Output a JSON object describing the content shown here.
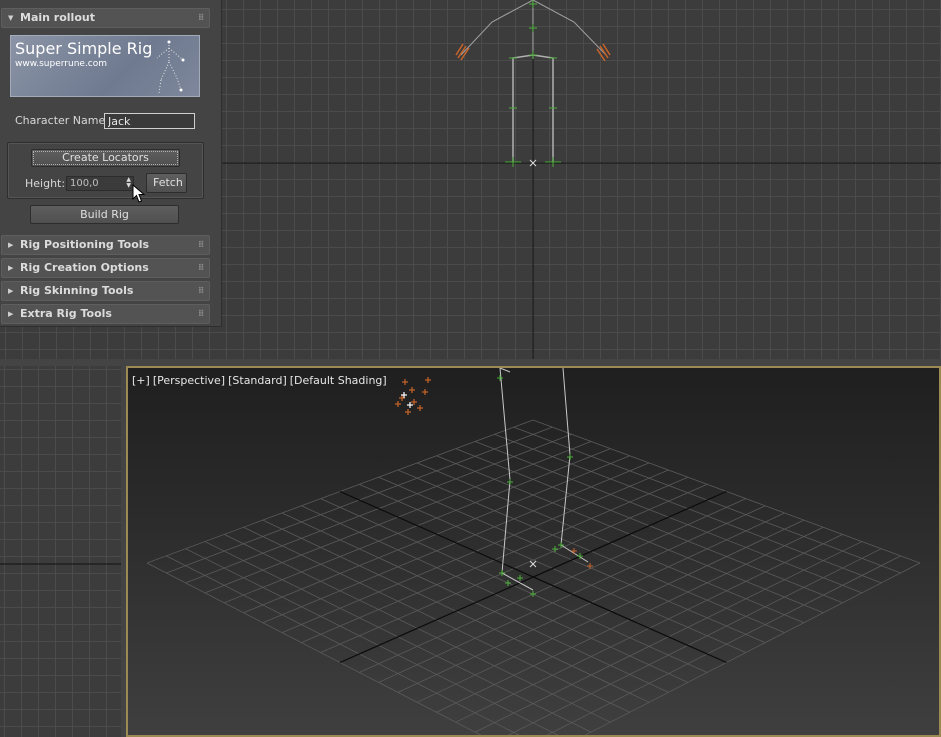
{
  "panel": {
    "main_rollout": {
      "title": "Main rollout",
      "logo_title": "Super Simple Rig",
      "logo_url": "www.superrune.com",
      "character_name_label": "Character Name:",
      "character_name_value": "Jack",
      "create_locators_label": "Create Locators",
      "height_label": "Height:",
      "height_value": "100,0",
      "fetch_label": "Fetch",
      "build_rig_label": "Build Rig"
    },
    "collapsed_rollouts": [
      {
        "title": "Rig Positioning Tools"
      },
      {
        "title": "Rig Creation Options"
      },
      {
        "title": "Rig Skinning Tools"
      },
      {
        "title": "Extra Rig Tools"
      }
    ]
  },
  "viewport_perspective": {
    "labels": [
      "[+]",
      "[Perspective]",
      "[Standard]",
      "[Default Shading]"
    ]
  },
  "colors": {
    "viewport_active_border": "#9b8a52",
    "joint_green": "#4caf3a",
    "hand_orange": "#c8642a",
    "grid_line": "#4b4b4b"
  },
  "icons": {
    "expanded": "triangle-down-icon",
    "collapsed": "triangle-right-icon",
    "grip": "grip-dots-icon",
    "cursor": "mouse-pointer-icon"
  }
}
